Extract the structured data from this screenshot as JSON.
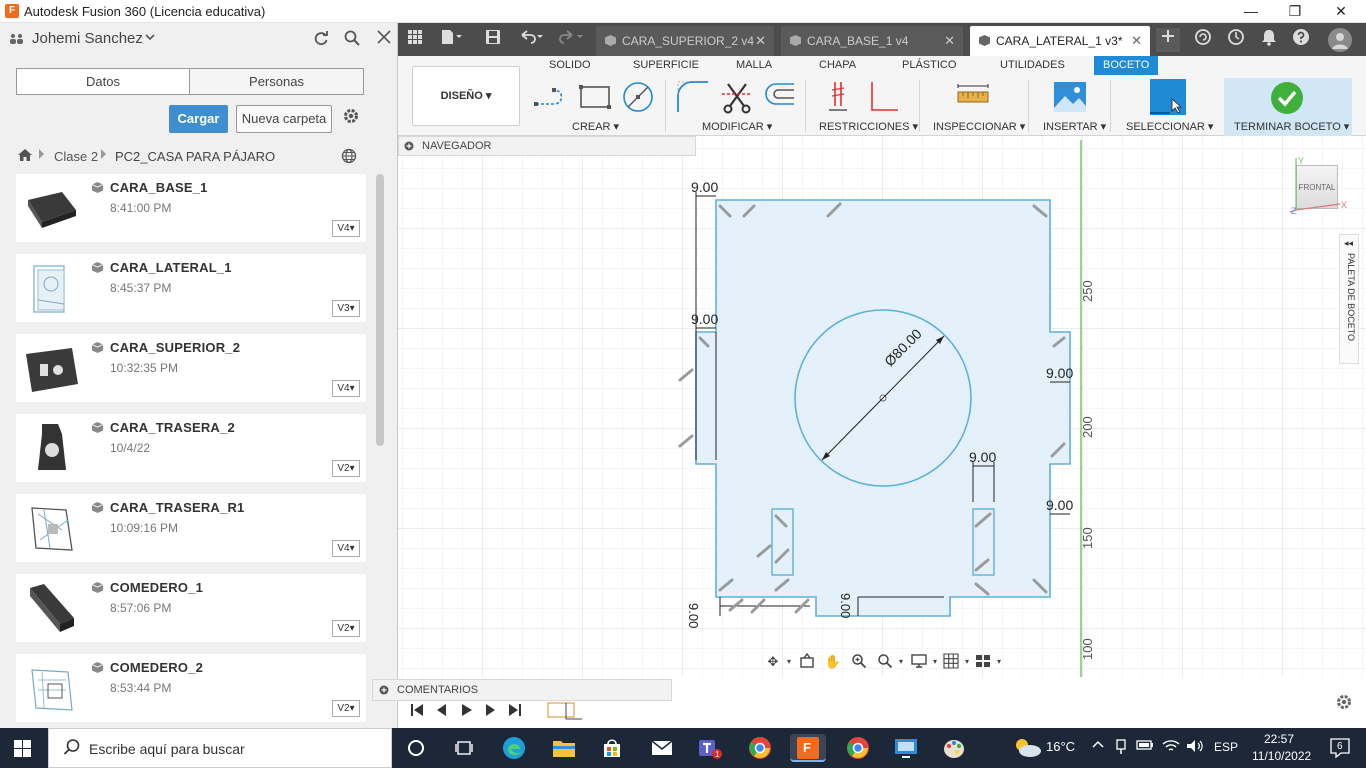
{
  "window": {
    "app_icon": "F",
    "title": "Autodesk Fusion 360 (Licencia educativa)",
    "minimize": "—",
    "maximize": "❐",
    "close": "✕"
  },
  "data_panel": {
    "user_name": "Johemi Sanchez",
    "tabs": [
      "Datos",
      "Personas"
    ],
    "upload_label": "Cargar",
    "new_folder_label": "Nueva carpeta",
    "breadcrumb": [
      "Clase 2",
      "PC2_CASA PARA PÁJARO"
    ],
    "files": [
      {
        "name": "CARA_BASE_1",
        "time": "8:41:00 PM",
        "version": "V4"
      },
      {
        "name": "CARA_LATERAL_1",
        "time": "8:45:37 PM",
        "version": "V3"
      },
      {
        "name": "CARA_SUPERIOR_2",
        "time": "10:32:35 PM",
        "version": "V4"
      },
      {
        "name": "CARA_TRASERA_2",
        "time": "10/4/22",
        "version": "V2"
      },
      {
        "name": "CARA_TRASERA_R1",
        "time": "10:09:16 PM",
        "version": "V4"
      },
      {
        "name": "COMEDERO_1",
        "time": "8:57:06 PM",
        "version": "V2"
      },
      {
        "name": "COMEDERO_2",
        "time": "8:53:44 PM",
        "version": "V2"
      }
    ]
  },
  "doc_tabs": [
    {
      "label": "CARA_SUPERIOR_2 v4",
      "active": false
    },
    {
      "label": "CARA_BASE_1 v4",
      "active": false
    },
    {
      "label": "CARA_LATERAL_1 v3*",
      "active": true
    }
  ],
  "toolbar": {
    "workspace": "DISEÑO ▾",
    "tabs": [
      "SOLIDO",
      "SUPERFICIE",
      "MALLA",
      "CHAPA",
      "PLÁSTICO",
      "UTILIDADES",
      "BOCETO"
    ],
    "groups": [
      "CREAR ▾",
      "MODIFICAR ▾",
      "RESTRICCIONES ▾",
      "INSPECCIONAR ▾",
      "INSERTAR ▾",
      "SELECCIONAR ▾",
      "TERMINAR BOCETO ▾"
    ]
  },
  "browser": {
    "navigator_label": "NAVEGADOR",
    "comments_label": "COMENTARIOS",
    "viewcube_label": "FRONTAL",
    "palette_label": "PALETA DE BOCETO"
  },
  "sketch": {
    "dims": [
      "9.00",
      "9.00",
      "9.00",
      "9.00",
      "9.00",
      "9.00",
      "9.00"
    ],
    "diameter": "Ø80.00",
    "ruler": [
      "250",
      "200",
      "150",
      "100"
    ]
  },
  "taskbar": {
    "search_placeholder": "Escribe aquí para buscar",
    "temperature": "16°C",
    "language": "ESP",
    "time": "22:57",
    "date": "11/10/2022",
    "notifications": "6"
  },
  "colors": {
    "accent": "#1f8ad6",
    "sketch_fill": "#e5f1fa",
    "sketch_line": "#5fb0dc",
    "taskbar": "#1c2838"
  }
}
